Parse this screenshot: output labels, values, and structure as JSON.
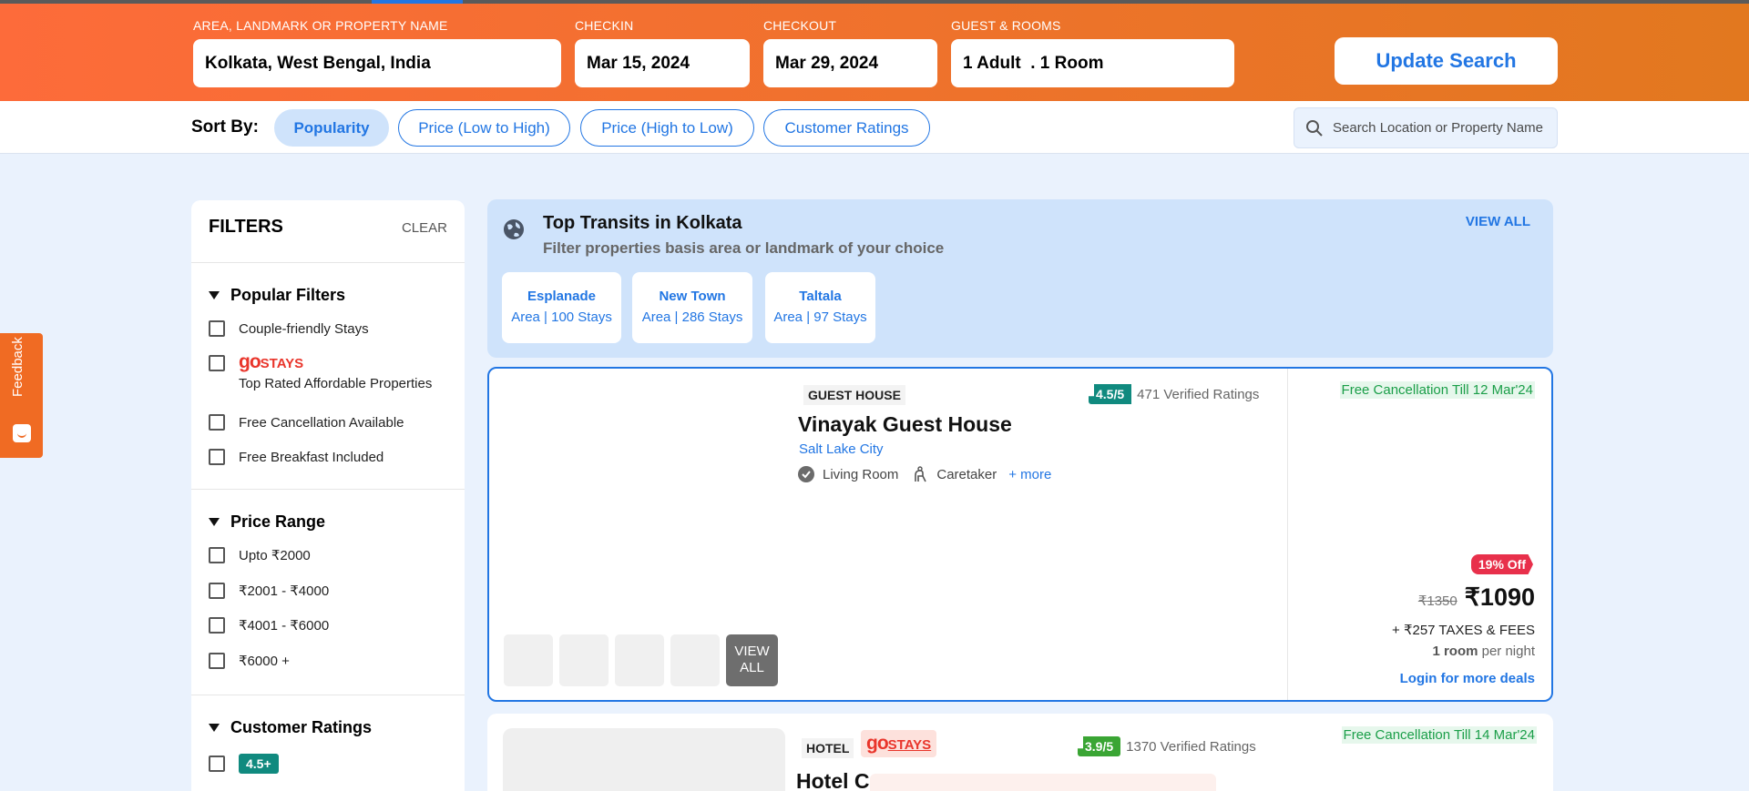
{
  "search": {
    "area_label": "AREA, LANDMARK OR PROPERTY NAME",
    "area_value": "Kolkata, West Bengal, India",
    "checkin_label": "CHECKIN",
    "checkin_value": "Mar 15, 2024",
    "checkout_label": "CHECKOUT",
    "checkout_value": "Mar 29, 2024",
    "guests_label": "GUEST & ROOMS",
    "guests_value": "1 Adult  . 1 Room",
    "update_label": "Update Search"
  },
  "sort": {
    "label": "Sort By:",
    "options": [
      "Popularity",
      "Price (Low to High)",
      "Price (High to Low)",
      "Customer Ratings"
    ],
    "active": "Popularity",
    "search_placeholder": "Search Location or Property Name"
  },
  "feedback_label": "Feedback",
  "filters": {
    "title": "FILTERS",
    "clear": "CLEAR",
    "popular": {
      "title": "Popular Filters",
      "items": [
        "Couple-friendly Stays",
        "Top Rated Affordable Properties",
        "Free Cancellation Available",
        "Free Breakfast Included"
      ],
      "gostays_go": "go",
      "gostays_stays": "STAYS"
    },
    "price": {
      "title": "Price Range",
      "items": [
        "Upto ₹2000",
        "₹2001 - ₹4000",
        "₹4001 - ₹6000",
        "₹6000 +"
      ]
    },
    "ratings": {
      "title": "Customer Ratings",
      "items": [
        "4.5+"
      ]
    }
  },
  "transits": {
    "title": "Top Transits in Kolkata",
    "subtitle": "Filter properties basis area or landmark of your choice",
    "view_all": "VIEW ALL",
    "cards": [
      {
        "name": "Esplanade",
        "detail": "Area | 100 Stays"
      },
      {
        "name": "New Town",
        "detail": "Area | 286 Stays"
      },
      {
        "name": "Taltala",
        "detail": "Area | 97 Stays"
      }
    ]
  },
  "property1": {
    "type": "GUEST HOUSE",
    "rating": "4.5/5",
    "ratings_count": "471 Verified Ratings",
    "name": "Vinayak Guest House",
    "location": "Salt Lake City",
    "amenities": [
      "Living Room",
      "Caretaker"
    ],
    "more": "+ more",
    "free_cancellation": "Free Cancellation Till 12 Mar'24",
    "discount": "19% Off",
    "old_price": "₹1350",
    "price": "₹1090",
    "taxes": "+ ₹257 TAXES & FEES",
    "per_night_bold": "1 room",
    "per_night": " per night",
    "login_deals": "Login for more deals",
    "view_all_line1": "VIEW",
    "view_all_line2": "ALL"
  },
  "property2": {
    "type": "HOTEL",
    "gostays_go": "go",
    "gostays_stays": "STAYS",
    "rating": "3.9/5",
    "ratings_count": "1370 Verified Ratings",
    "name": "Hotel C",
    "free_cancellation": "Free Cancellation Till 14 Mar'24"
  },
  "colors": {
    "brand_orange": "#fd6b3a",
    "accent_blue": "#2276e3",
    "rating_teal": "#108a7f",
    "rating_green": "#3aa534",
    "discount_red": "#e8304b"
  }
}
